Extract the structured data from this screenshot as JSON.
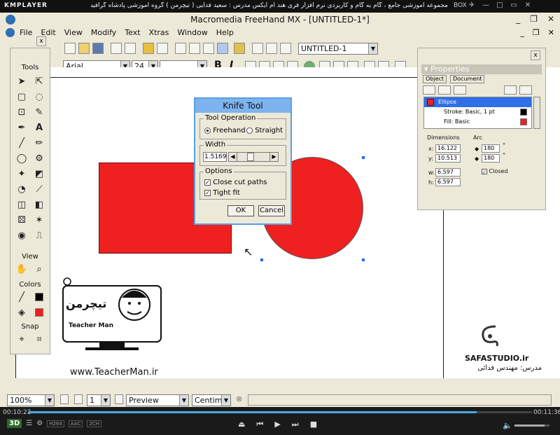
{
  "player": {
    "logo": "KMPLAYER",
    "title": "مجموعه آموزشی جامع ، گام به گام و کاربردی نرم افزار فری هند ام ایکس   مدرس : سعید فدایی ( تیچرمن ) گروه آموزشی پادشاه گرافیست ها",
    "box_label": "BOX",
    "time_current": "00:10:22",
    "time_total": "00:11:36",
    "progress_fraction": 0.89,
    "volume_fraction": 0.85,
    "badge_3d": "3D",
    "tags": [
      "H264",
      "AAC",
      "2CH"
    ]
  },
  "app": {
    "title": "Macromedia FreeHand MX - [UNTITLED-1*]",
    "menu": [
      "File",
      "Edit",
      "View",
      "Modify",
      "Text",
      "Xtras",
      "Window",
      "Help"
    ],
    "doc_select": "UNTITLED-1",
    "font_name": "Arial",
    "font_size": "24",
    "bold": "B",
    "italic": "I"
  },
  "tools_panel": {
    "title": "Tools",
    "view_title": "View",
    "colors_title": "Colors",
    "snap_title": "Snap",
    "close": "x"
  },
  "knife": {
    "title": "Knife Tool",
    "operation_label": "Tool Operation",
    "freehand": "Freehand",
    "straight": "Straight",
    "width_label": "Width",
    "width_value": "1.5169",
    "options_label": "Options",
    "close_cut": "Close cut paths",
    "tight_fit": "Tight fit",
    "ok": "OK",
    "cancel": "Cancel"
  },
  "properties": {
    "title": "Properties",
    "tab_object": "Object",
    "tab_document": "Document",
    "close": "x",
    "items": [
      "Ellipse",
      "Stroke: Basic, 1 pt",
      "Fill: Basic"
    ],
    "dimensions_label": "Dimensions",
    "arc_label": "Arc",
    "x_label": "x:",
    "x_val": "16.122",
    "y_label": "y:",
    "y_val": "10.513",
    "w_label": "w:",
    "w_val": "6.597",
    "h_label": "h:",
    "h_val": "6.597",
    "arc1": "180",
    "arc2": "180",
    "closed": "Closed",
    "degree": "°"
  },
  "status": {
    "zoom": "100%",
    "page": "1",
    "mode": "Preview",
    "units": "Centimeters"
  },
  "watermark": {
    "logo_text": "تیچرمن",
    "logo_sub": "Teacher Man",
    "url": "www.TeacherMan.ir",
    "safa": "SAFASTUDIO.ir",
    "safa_sub": "مدرس: مهندس فدائی"
  },
  "colors": {
    "accent": "#ef2020",
    "selection": "#2f6fe8",
    "dialog_title": "#7db4ee"
  }
}
